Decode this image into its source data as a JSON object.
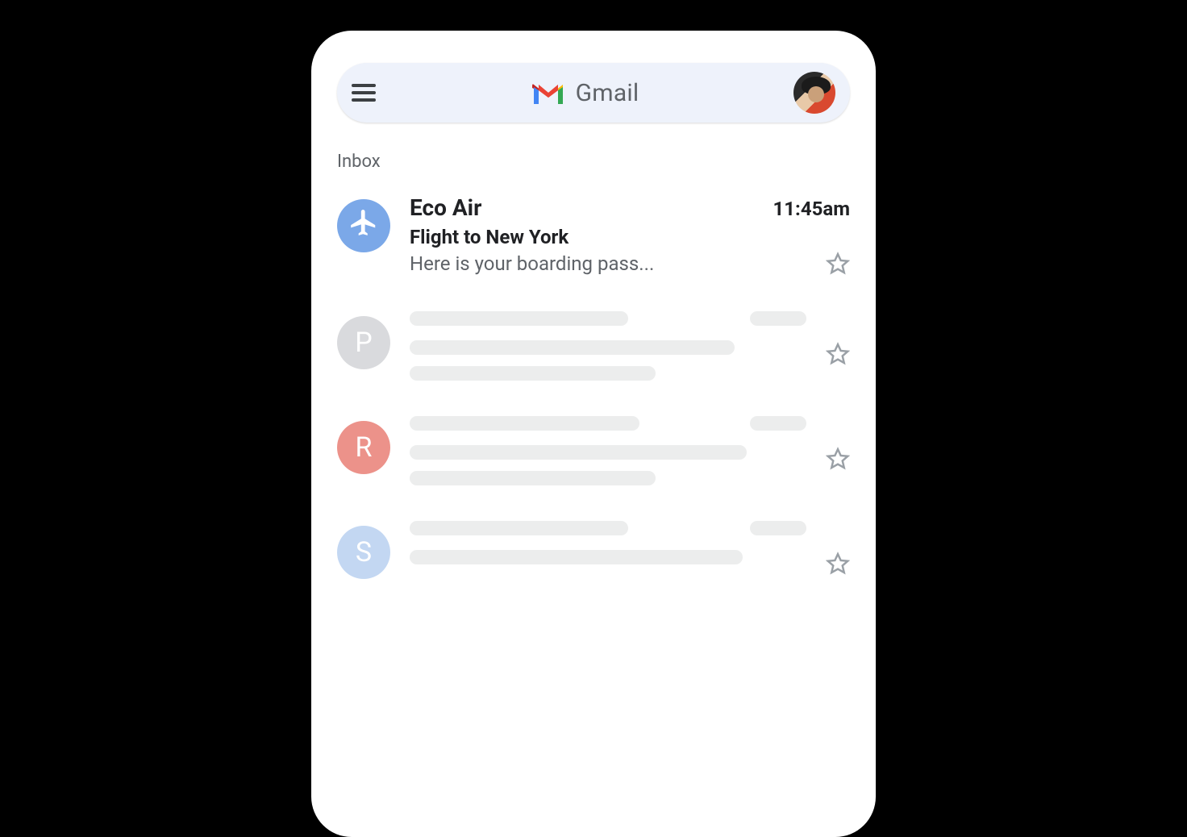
{
  "header": {
    "brand_label": "Gmail",
    "menu_icon": "hamburger-menu-icon",
    "avatar_desc": "profile-avatar"
  },
  "inbox": {
    "section_label": "Inbox",
    "emails": [
      {
        "avatar_icon": "airplane-icon",
        "avatar_color": "#7ba8e8",
        "sender": "Eco Air",
        "time": "11:45am",
        "subject": "Flight to New York",
        "snippet": "Here is your boarding pass...",
        "starred": false
      }
    ],
    "placeholder_rows": [
      {
        "avatar_letter": "P",
        "avatar_class": "av-grey"
      },
      {
        "avatar_letter": "R",
        "avatar_class": "av-red"
      },
      {
        "avatar_letter": "S",
        "avatar_class": "av-lblue"
      }
    ]
  }
}
